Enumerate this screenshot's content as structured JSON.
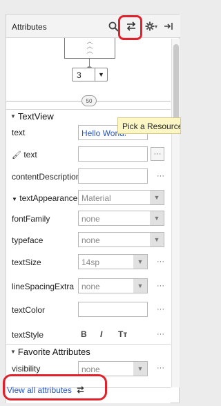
{
  "header": {
    "title": "Attributes",
    "icons": [
      "search-icon",
      "swap-icon",
      "gear-icon",
      "expand-icon"
    ],
    "gear_caret": "▾"
  },
  "layout_widget": {
    "margin_value": "3",
    "bias_value": "50"
  },
  "textview_section": {
    "title": "TextView",
    "rows": {
      "text_label": "text",
      "text_value": "Hello World!",
      "tools_text_label": "text",
      "content_desc_label": "contentDescription",
      "text_appearance_label": "textAppearance",
      "text_appearance_value": "Material",
      "font_family_label": "fontFamily",
      "font_family_value": "none",
      "typeface_label": "typeface",
      "typeface_value": "none",
      "text_size_label": "textSize",
      "text_size_value": "14sp",
      "line_spacing_label": "lineSpacingExtra",
      "line_spacing_value": "none",
      "text_color_label": "textColor",
      "text_style_label": "textStyle",
      "text_style_bold": "B",
      "text_style_italic": "I",
      "text_style_caps": "Tт"
    },
    "ellipsis": "···"
  },
  "tooltip": "Pick a Resource",
  "favorites_section": {
    "title": "Favorite Attributes",
    "visibility_label": "visibility",
    "visibility_value": "none"
  },
  "footer": {
    "link_label": "View all attributes",
    "link_icon": "swap-icon"
  },
  "colors": {
    "highlight": "#e0202a",
    "link": "#2454c6",
    "tooltip_bg": "#fbf6c4"
  }
}
